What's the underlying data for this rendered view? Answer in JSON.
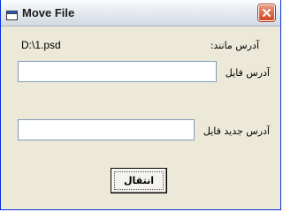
{
  "window": {
    "title": "Move File",
    "icon": "window-icon",
    "close_icon": "close-icon"
  },
  "form": {
    "remaining_address_label": "آدرس مانند:",
    "remaining_address_value": "D:\\1.psd",
    "file_address_label": "آدرس فایل",
    "file_address_value": "",
    "new_file_address_label": "آدرس جدید فایل",
    "new_file_address_value": "",
    "move_button_label": "انتقال"
  }
}
